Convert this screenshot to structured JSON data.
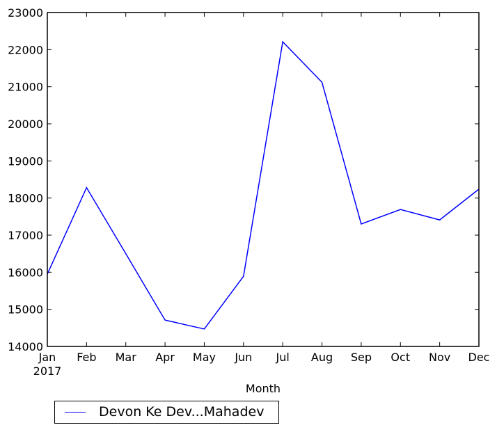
{
  "chart_data": {
    "type": "line",
    "title": "",
    "xlabel": "Month",
    "ylabel": "",
    "x_year_label": "2017",
    "categories": [
      "Jan",
      "Feb",
      "Mar",
      "Apr",
      "May",
      "Jun",
      "Jul",
      "Aug",
      "Sep",
      "Oct",
      "Nov",
      "Dec"
    ],
    "ylim": [
      14000,
      23000
    ],
    "yticks": [
      14000,
      15000,
      16000,
      17000,
      18000,
      19000,
      20000,
      21000,
      22000,
      23000
    ],
    "grid": false,
    "legend_placement": "bottom-left below axes",
    "series": [
      {
        "name": "Devon Ke Dev...Mahadev",
        "color": "#0000ff",
        "values": [
          15950,
          18280,
          16500,
          14710,
          14470,
          15890,
          22210,
          21120,
          17300,
          17690,
          17410,
          18240
        ]
      }
    ]
  },
  "legend": {
    "entries": [
      {
        "label": "Devon Ke Dev...Mahadev",
        "color": "#0000ff"
      }
    ]
  }
}
